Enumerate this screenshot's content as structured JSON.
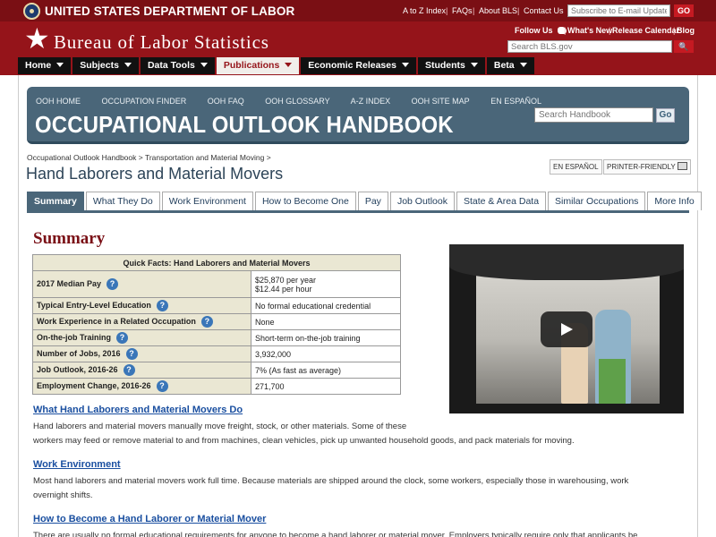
{
  "header": {
    "dol_title": "UNITED STATES DEPARTMENT OF LABOR",
    "top_links": [
      "A to Z Index",
      "FAQs",
      "About BLS",
      "Contact Us"
    ],
    "subscribe_placeholder": "Subscribe to E-mail Updates",
    "go_label": "GO",
    "bls_title": "Bureau of Labor Statistics",
    "follow_us": "Follow Us",
    "social_links": [
      "What's New",
      "Release Calendar",
      "Blog"
    ],
    "search_placeholder": "Search BLS.gov",
    "brand_color": "#95141a"
  },
  "nav": {
    "items": [
      {
        "label": "Home",
        "active": false
      },
      {
        "label": "Subjects",
        "active": false
      },
      {
        "label": "Data Tools",
        "active": false
      },
      {
        "label": "Publications",
        "active": true
      },
      {
        "label": "Economic Releases",
        "active": false
      },
      {
        "label": "Students",
        "active": false
      },
      {
        "label": "Beta",
        "active": false
      }
    ]
  },
  "ooh": {
    "links": [
      "OOH HOME",
      "OCCUPATION FINDER",
      "OOH FAQ",
      "OOH GLOSSARY",
      "A-Z INDEX",
      "OOH SITE MAP",
      "EN ESPAÑOL"
    ],
    "title": "OCCUPATIONAL OUTLOOK HANDBOOK",
    "search_placeholder": "Search Handbook",
    "go_label": "Go"
  },
  "breadcrumb": [
    "Occupational Outlook Handbook",
    "Transportation and Material Moving"
  ],
  "page": {
    "title": "Hand Laborers and Material Movers",
    "espanol_label": "EN ESPAÑOL",
    "print_label": "PRINTER-FRIENDLY"
  },
  "tabs": [
    "Summary",
    "What They Do",
    "Work Environment",
    "How to Become One",
    "Pay",
    "Job Outlook",
    "State & Area Data",
    "Similar Occupations",
    "More Info"
  ],
  "summary": {
    "heading": "Summary",
    "table_title": "Quick Facts: Hand Laborers and Material Movers",
    "rows": [
      {
        "label": "2017 Median Pay",
        "value": "$25,870 per year",
        "value2": "$12.44 per hour"
      },
      {
        "label": "Typical Entry-Level Education",
        "value": "No formal educational credential"
      },
      {
        "label": "Work Experience in a Related Occupation",
        "value": "None"
      },
      {
        "label": "On-the-job Training",
        "value": "Short-term on-the-job training"
      },
      {
        "label": "Number of Jobs, 2016",
        "value": "3,932,000"
      },
      {
        "label": "Job Outlook, 2016-26",
        "value": "7% (As fast as average)"
      },
      {
        "label": "Employment Change, 2016-26",
        "value": "271,700"
      }
    ]
  },
  "sections": [
    {
      "heading": "What Hand Laborers and Material Movers Do",
      "lines": [
        "Hand laborers and material movers manually move freight, stock, or other materials. Some of these",
        "workers may feed or remove material to and from machines, clean vehicles, pick up unwanted household goods, and pack materials for moving."
      ]
    },
    {
      "heading": "Work Environment",
      "lines": [
        "Most hand laborers and material movers work full time. Because materials are shipped around the clock, some workers, especially those in warehousing, work",
        "overnight shifts."
      ]
    },
    {
      "heading": "How to Become a Hand Laborer or Material Mover",
      "lines": [
        "There are usually no formal educational requirements for anyone to become a hand laborer or material mover. Employers typically require only that applicants be"
      ]
    }
  ]
}
